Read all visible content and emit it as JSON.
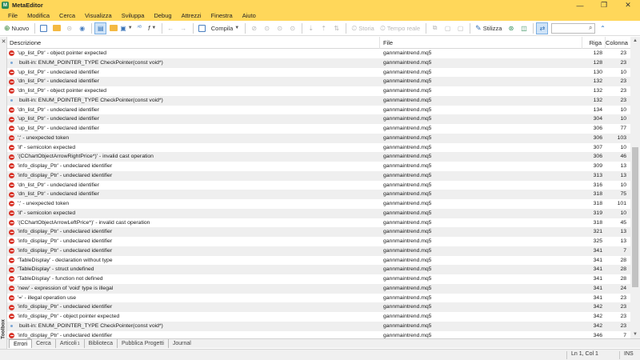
{
  "window": {
    "title": "MetaEditor",
    "minimize_glyph": "—",
    "maximize_glyph": "❐",
    "close_glyph": "✕"
  },
  "menu": [
    "File",
    "Modifica",
    "Cerca",
    "Visualizza",
    "Sviluppa",
    "Debug",
    "Attrezzi",
    "Finestra",
    "Aiuto"
  ],
  "toolbar": {
    "new_label": "Nuovo",
    "compile_label": "Compila",
    "history_label": "Storia",
    "realtime_label": "Tempo reale",
    "styler_label": "Stilizza"
  },
  "table": {
    "headers": {
      "description": "Descrizione",
      "file": "File",
      "line": "Riga",
      "column": "Colonna"
    },
    "rows": [
      {
        "type": "error",
        "desc": "'up_list_Ptr' - object pointer expected",
        "file": "gannmaintrend.mq5",
        "line": "128",
        "col": "23"
      },
      {
        "type": "info",
        "desc": "built-in: ENUM_POINTER_TYPE CheckPointer(const void*)",
        "file": "gannmaintrend.mq5",
        "line": "128",
        "col": "23"
      },
      {
        "type": "error",
        "desc": "'up_list_Ptr' - undeclared identifier",
        "file": "gannmaintrend.mq5",
        "line": "130",
        "col": "10"
      },
      {
        "type": "error",
        "desc": "'dn_list_Ptr' - undeclared identifier",
        "file": "gannmaintrend.mq5",
        "line": "132",
        "col": "23"
      },
      {
        "type": "error",
        "desc": "'dn_list_Ptr' - object pointer expected",
        "file": "gannmaintrend.mq5",
        "line": "132",
        "col": "23"
      },
      {
        "type": "info",
        "desc": "built-in: ENUM_POINTER_TYPE CheckPointer(const void*)",
        "file": "gannmaintrend.mq5",
        "line": "132",
        "col": "23"
      },
      {
        "type": "error",
        "desc": "'dn_list_Ptr' - undeclared identifier",
        "file": "gannmaintrend.mq5",
        "line": "134",
        "col": "10"
      },
      {
        "type": "error",
        "desc": "'up_list_Ptr' - undeclared identifier",
        "file": "gannmaintrend.mq5",
        "line": "304",
        "col": "10"
      },
      {
        "type": "error",
        "desc": "'up_list_Ptr' - undeclared identifier",
        "file": "gannmaintrend.mq5",
        "line": "306",
        "col": "77"
      },
      {
        "type": "error",
        "desc": "';' - unexpected token",
        "file": "gannmaintrend.mq5",
        "line": "306",
        "col": "103"
      },
      {
        "type": "error",
        "desc": "'if' - semicolon expected",
        "file": "gannmaintrend.mq5",
        "line": "307",
        "col": "10"
      },
      {
        "type": "error",
        "desc": "'(CChartObjectArrowRightPrice*)' - invalid cast operation",
        "file": "gannmaintrend.mq5",
        "line": "306",
        "col": "46"
      },
      {
        "type": "error",
        "desc": "'info_display_Ptr' - undeclared identifier",
        "file": "gannmaintrend.mq5",
        "line": "309",
        "col": "13"
      },
      {
        "type": "error",
        "desc": "'info_display_Ptr' - undeclared identifier",
        "file": "gannmaintrend.mq5",
        "line": "313",
        "col": "13"
      },
      {
        "type": "error",
        "desc": "'dn_list_Ptr' - undeclared identifier",
        "file": "gannmaintrend.mq5",
        "line": "316",
        "col": "10"
      },
      {
        "type": "error",
        "desc": "'dn_list_Ptr' - undeclared identifier",
        "file": "gannmaintrend.mq5",
        "line": "318",
        "col": "75"
      },
      {
        "type": "error",
        "desc": "';' - unexpected token",
        "file": "gannmaintrend.mq5",
        "line": "318",
        "col": "101"
      },
      {
        "type": "error",
        "desc": "'if' - semicolon expected",
        "file": "gannmaintrend.mq5",
        "line": "319",
        "col": "10"
      },
      {
        "type": "error",
        "desc": "'(CChartObjectArrowLeftPrice*)' - invalid cast operation",
        "file": "gannmaintrend.mq5",
        "line": "318",
        "col": "45"
      },
      {
        "type": "error",
        "desc": "'info_display_Ptr' - undeclared identifier",
        "file": "gannmaintrend.mq5",
        "line": "321",
        "col": "13"
      },
      {
        "type": "error",
        "desc": "'info_display_Ptr' - undeclared identifier",
        "file": "gannmaintrend.mq5",
        "line": "325",
        "col": "13"
      },
      {
        "type": "error",
        "desc": "'info_display_Ptr' - undeclared identifier",
        "file": "gannmaintrend.mq5",
        "line": "341",
        "col": "7"
      },
      {
        "type": "error",
        "desc": "'TableDisplay' - declaration without type",
        "file": "gannmaintrend.mq5",
        "line": "341",
        "col": "28"
      },
      {
        "type": "error",
        "desc": "'TableDisplay' - struct undefined",
        "file": "gannmaintrend.mq5",
        "line": "341",
        "col": "28"
      },
      {
        "type": "error",
        "desc": "'TableDisplay' - function not defined",
        "file": "gannmaintrend.mq5",
        "line": "341",
        "col": "28"
      },
      {
        "type": "error",
        "desc": "'new' - expression of 'void' type is illegal",
        "file": "gannmaintrend.mq5",
        "line": "341",
        "col": "24"
      },
      {
        "type": "error",
        "desc": "'=' - illegal operation use",
        "file": "gannmaintrend.mq5",
        "line": "341",
        "col": "23"
      },
      {
        "type": "error",
        "desc": "'info_display_Ptr' - undeclared identifier",
        "file": "gannmaintrend.mq5",
        "line": "342",
        "col": "23"
      },
      {
        "type": "error",
        "desc": "'info_display_Ptr' - object pointer expected",
        "file": "gannmaintrend.mq5",
        "line": "342",
        "col": "23"
      },
      {
        "type": "info",
        "desc": "built-in: ENUM_POINTER_TYPE CheckPointer(const void*)",
        "file": "gannmaintrend.mq5",
        "line": "342",
        "col": "23"
      },
      {
        "type": "error",
        "desc": "'info_display_Ptr' - undeclared identifier",
        "file": "gannmaintrend.mq5",
        "line": "346",
        "col": "7"
      }
    ]
  },
  "tabs": [
    {
      "label": "Errori",
      "active": true,
      "sub": ""
    },
    {
      "label": "Cerca",
      "active": false,
      "sub": ""
    },
    {
      "label": "Articoli",
      "active": false,
      "sub": "1"
    },
    {
      "label": "Biblioteca",
      "active": false,
      "sub": ""
    },
    {
      "label": "Pubblica Progetti",
      "active": false,
      "sub": ""
    },
    {
      "label": "Journal",
      "active": false,
      "sub": ""
    }
  ],
  "toolbox_label": "Toolbox",
  "status": {
    "position": "Ln 1, Col 1",
    "mode": "INS"
  },
  "colors": {
    "accent": "#ffd75a",
    "error": "#d8362b",
    "alt_row": "#efefef"
  }
}
